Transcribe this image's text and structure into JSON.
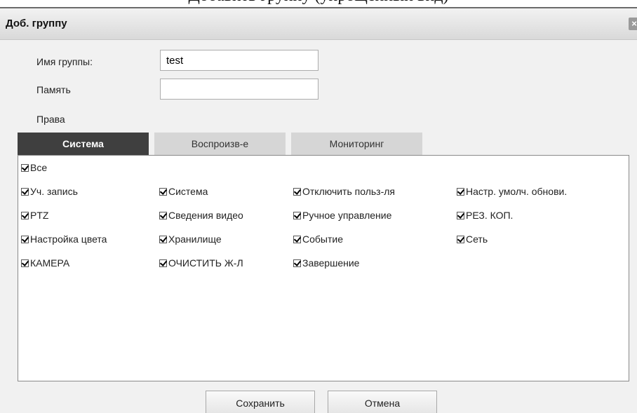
{
  "background_heading": "Добавить группу (упрощенный вид)",
  "dialog": {
    "title": "Доб. группу",
    "close_glyph": "×"
  },
  "form": {
    "group_name_label": "Имя группы:",
    "group_name_value": "test",
    "memo_label": "Память",
    "memo_value": "",
    "rights_label": "Права"
  },
  "tabs": [
    {
      "label": "Система",
      "active": true
    },
    {
      "label": "Воспроизв-е",
      "active": false
    },
    {
      "label": "Мониторинг",
      "active": false
    }
  ],
  "permissions": {
    "all": {
      "label": "Все",
      "checked": true
    },
    "items": [
      {
        "label": "Уч. запись",
        "checked": true
      },
      {
        "label": "Система",
        "checked": true
      },
      {
        "label": "Отключить польз-ля",
        "checked": true
      },
      {
        "label": "Настр. умолч. обнови.",
        "checked": true
      },
      {
        "label": "PTZ",
        "checked": true
      },
      {
        "label": "Сведения видео",
        "checked": true
      },
      {
        "label": "Ручное управление",
        "checked": true
      },
      {
        "label": "РЕЗ. КОП.",
        "checked": true
      },
      {
        "label": "Настройка цвета",
        "checked": true
      },
      {
        "label": "Хранилище",
        "checked": true
      },
      {
        "label": "Событие",
        "checked": true
      },
      {
        "label": "Сеть",
        "checked": true
      },
      {
        "label": "КАМЕРА",
        "checked": true
      },
      {
        "label": "ОЧИСТИТЬ Ж-Л",
        "checked": true
      },
      {
        "label": "Завершение",
        "checked": true
      }
    ]
  },
  "buttons": {
    "save": "Сохранить",
    "cancel": "Отмена"
  }
}
